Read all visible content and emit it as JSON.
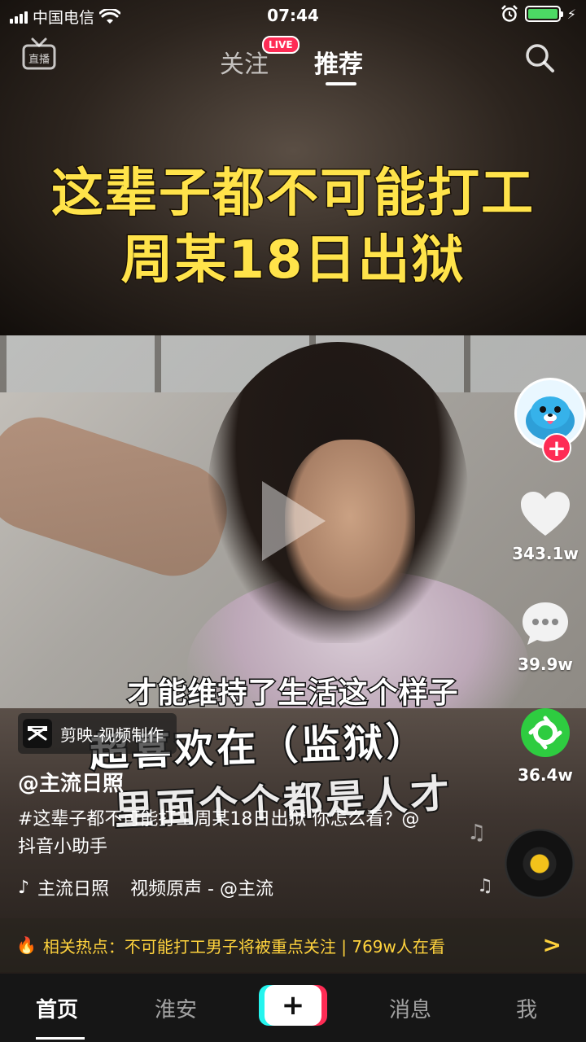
{
  "status_bar": {
    "carrier": "中国电信",
    "time": "07:44"
  },
  "top_nav": {
    "live_label": "直播",
    "follow_tab": "关注",
    "live_badge": "LIVE",
    "recommend_tab": "推荐",
    "active_tab": "推荐"
  },
  "video": {
    "headline_line1": "这辈子都不可能打工",
    "headline_line2": "周某18日出狱",
    "subtitle": "才能维持了生活这个样子",
    "brush_text_line1": "超喜欢在（监狱）",
    "brush_text_line2": "里面个个都是人才"
  },
  "rail": {
    "likes": "343.1w",
    "comments": "39.9w",
    "shares": "36.4w"
  },
  "info": {
    "capcut_label": "剪映-视频制作",
    "author": "@主流日照",
    "description": "#这辈子都不可能打工周某18日出狱 你怎么看？@抖音小助手",
    "music_author": "主流日照",
    "music_title": "视频原声 - @主流"
  },
  "hot": {
    "label": "相关热点：不可能打工男子将被重点关注 | 769w人在看"
  },
  "bottom_nav": {
    "home": "首页",
    "city": "淮安",
    "message": "消息",
    "me": "我",
    "active": "首页"
  },
  "colors": {
    "accent_pink": "#fe2c55",
    "accent_cyan": "#25f4ee",
    "headline_yellow": "#ffe34a",
    "hot_yellow": "#ffd33d",
    "share_green": "#2ecc40",
    "battery_green": "#4cd964"
  }
}
